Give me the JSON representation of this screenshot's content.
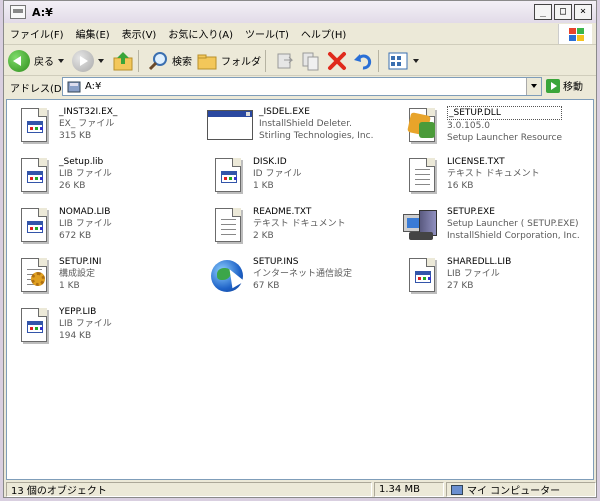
{
  "window": {
    "title": "A:¥"
  },
  "menu": [
    "ファイル(F)",
    "編集(E)",
    "表示(V)",
    "お気に入り(A)",
    "ツール(T)",
    "ヘルプ(H)"
  ],
  "toolbar": {
    "back": "戻る",
    "search": "検索",
    "folders": "フォルダ"
  },
  "address": {
    "label": "アドレス(D)",
    "value": "A:¥",
    "go": "移動"
  },
  "files": [
    {
      "name": "_INST32I.EX_",
      "type": "EX_ ファイル",
      "detail": "315 KB",
      "icon": "doc-window-icon"
    },
    {
      "name": "_ISDEL.EXE",
      "type": "InstallShield Deleter.",
      "detail": "Stirling Technologies, Inc.",
      "icon": "exe-window-icon"
    },
    {
      "name": "_SETUP.DLL",
      "type": "3.0.105.0",
      "detail": "Setup Launcher Resource",
      "icon": "dll-puzzle-icon"
    },
    {
      "name": "_Setup.lib",
      "type": "LIB ファイル",
      "detail": "26 KB",
      "icon": "doc-window-icon"
    },
    {
      "name": "DISK.ID",
      "type": "ID ファイル",
      "detail": "1 KB",
      "icon": "doc-window-icon"
    },
    {
      "name": "LICENSE.TXT",
      "type": "テキスト ドキュメント",
      "detail": "16 KB",
      "icon": "text-document-icon"
    },
    {
      "name": "NOMAD.LIB",
      "type": "LIB ファイル",
      "detail": "672 KB",
      "icon": "doc-window-icon"
    },
    {
      "name": "README.TXT",
      "type": "テキスト ドキュメント",
      "detail": "2 KB",
      "icon": "text-document-icon"
    },
    {
      "name": "SETUP.EXE",
      "type": "Setup Launcher ( SETUP.EXE)",
      "detail": "InstallShield Corporation, Inc.",
      "icon": "setup-computer-icon"
    },
    {
      "name": "SETUP.INI",
      "type": "構成設定",
      "detail": "1 KB",
      "icon": "ini-settings-icon"
    },
    {
      "name": "SETUP.INS",
      "type": "インターネット通信設定",
      "detail": "67 KB",
      "icon": "internet-shortcut-icon"
    },
    {
      "name": "SHAREDLL.LIB",
      "type": "LIB ファイル",
      "detail": "27 KB",
      "icon": "doc-window-icon"
    },
    {
      "name": "YEPP.LIB",
      "type": "LIB ファイル",
      "detail": "194 KB",
      "icon": "doc-window-icon"
    }
  ],
  "status": {
    "count": "13 個のオブジェクト",
    "size": "1.34 MB",
    "location": "マイ コンピューター"
  }
}
